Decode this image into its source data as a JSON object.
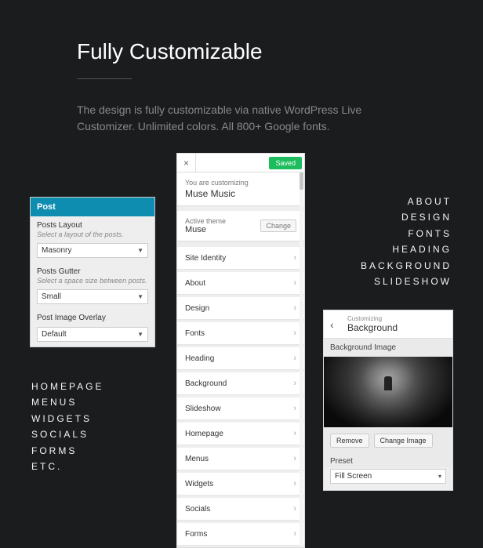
{
  "heading": "Fully Customizable",
  "subtext": "The design is fully customizable via native WordPress Live Customizer. Unlimited colors. All 800+ Google fonts.",
  "post_panel": {
    "title": "Post",
    "layout_label": "Posts Layout",
    "layout_desc": "Select a layout of the posts.",
    "layout_value": "Masonry",
    "gutter_label": "Posts Gutter",
    "gutter_desc": "Select a space size between posts.",
    "gutter_value": "Small",
    "overlay_label": "Post Image Overlay",
    "overlay_value": "Default"
  },
  "main_panel": {
    "saved": "Saved",
    "you_are": "You are customizing",
    "site": "Muse Music",
    "active_theme": "Active theme",
    "theme_name": "Muse",
    "change": "Change",
    "items": [
      "Site Identity",
      "About",
      "Design",
      "Fonts",
      "Heading",
      "Background",
      "Slideshow",
      "Homepage",
      "Menus",
      "Widgets",
      "Socials",
      "Forms"
    ]
  },
  "features_right": [
    "ABOUT",
    "DESIGN",
    "FONTS",
    "HEADING",
    "BACKGROUND",
    "SLIDESHOW"
  ],
  "features_left": [
    "HOMEPAGE",
    "MENUS",
    "WIDGETS",
    "SOCIALS",
    "FORMS",
    "ETC."
  ],
  "bg_panel": {
    "customizing": "Customizing",
    "title": "Background",
    "section": "Background Image",
    "remove": "Remove",
    "change_image": "Change Image",
    "preset_label": "Preset",
    "preset_value": "Fill Screen"
  }
}
